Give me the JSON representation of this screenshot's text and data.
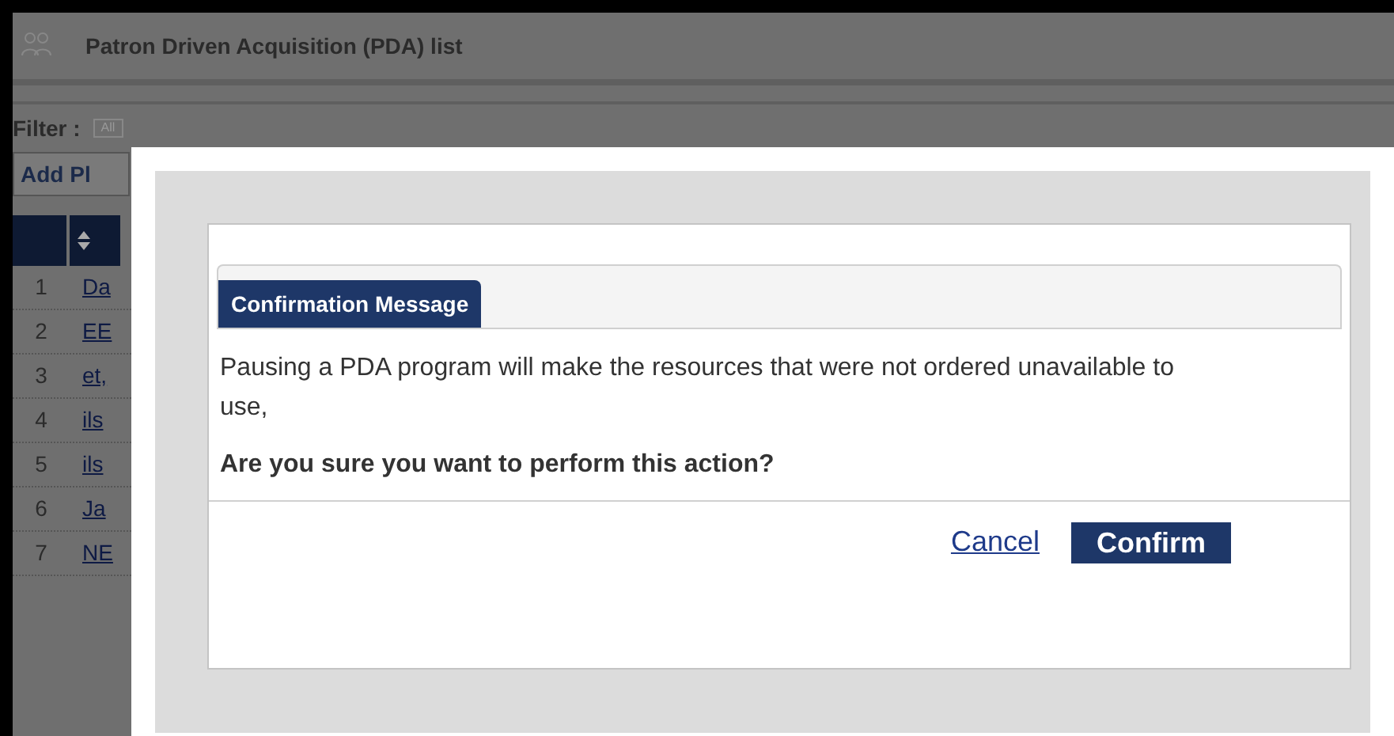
{
  "page": {
    "title": "Patron Driven Acquisition (PDA) list",
    "filter_label": "Filter :",
    "filter_value": "All",
    "add_button": "Add Pl",
    "rows": [
      {
        "number": "1",
        "link": "Da"
      },
      {
        "number": "2",
        "link": "EE"
      },
      {
        "number": "3",
        "link": "et,"
      },
      {
        "number": "4",
        "link": "ils"
      },
      {
        "number": "5",
        "link": "ils"
      },
      {
        "number": "6",
        "link": "Ja"
      },
      {
        "number": "7",
        "link": "NE"
      }
    ]
  },
  "dialog": {
    "tab": "Confirmation Message",
    "message": "Pausing a PDA program will make the resources that were not ordered unavailable to use,",
    "question": "Are you sure you want to perform this action?",
    "buttons": [
      {
        "kind": "link",
        "label": "Cancel"
      },
      {
        "kind": "primary",
        "label": "Confirm"
      }
    ]
  }
}
